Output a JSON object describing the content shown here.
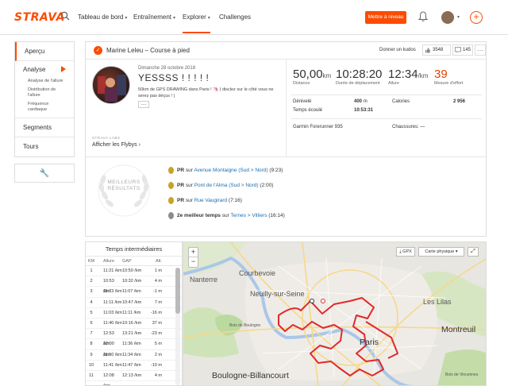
{
  "nav": {
    "logo": "STRAVA",
    "items": [
      {
        "label": "Tableau de bord",
        "caret": "▾"
      },
      {
        "label": "Entraînement",
        "caret": "▾"
      },
      {
        "label": "Explorer",
        "caret": "▾"
      },
      {
        "label": "Challenges",
        "caret": ""
      }
    ],
    "upgrade_label": "Mettre à niveau",
    "accent": "#fc4c02"
  },
  "sidebar": {
    "items": [
      "Aperçu",
      "Analyse",
      "Segments",
      "Tours"
    ],
    "analyse_sub": [
      "Analyse de l'allure",
      "Distribution de l'allure",
      "Fréquence cardiaque"
    ]
  },
  "activity": {
    "title": "Marine Leleu – Course à pied",
    "kudos_link": "Donner un kudos",
    "kudos_count": "3548",
    "comment_count": "145",
    "date": "Dimanche 28 octobre 2018",
    "name": "YESSSS ! ! ! ! !",
    "description": "50km de GPS DRAWING dans Paris ! 🦄 ( disclez sur le côté vous ne serez pas déçus ! )",
    "labs_label": "STRAVA LABS",
    "flyby_label": "Afficher les Flybys  ›",
    "stats": [
      {
        "value": "50,00",
        "unit": "km",
        "label": "Distance"
      },
      {
        "value": "10:28:20",
        "unit": "",
        "label": "Durée de déplacement"
      },
      {
        "value": "12:34",
        "unit": "/km",
        "label": "Allure"
      },
      {
        "value": "39",
        "unit": "",
        "label": "Mesure d'effort"
      }
    ],
    "details": {
      "elevation_label": "Dénivelé",
      "elevation_value": "400",
      "elevation_unit": "m",
      "calories_label": "Calories",
      "calories_value": "2 956",
      "elapsed_label": "Temps écoulé",
      "elapsed_value": "10:53:31",
      "device": "Garmin Forerunner 935",
      "shoes_label": "Chaussures:",
      "shoes_value": "—"
    }
  },
  "results": {
    "title_line1": "MEILLEURS",
    "title_line2": "RÉSULTATS",
    "rows": [
      {
        "prefix": "PR",
        "mid": " sur ",
        "link": "Avenue Montaigne (Sud > Nord)",
        "suffix": " (9:23)",
        "medal": "gold"
      },
      {
        "prefix": "PR",
        "mid": " sur ",
        "link": "Pont de l'Alma (Sud > Nord)",
        "suffix": " (2:00)",
        "medal": "gold"
      },
      {
        "prefix": "PR",
        "mid": " sur ",
        "link": "Rue Vaugirard",
        "suffix": " (7:16)",
        "medal": "gold"
      },
      {
        "prefix": "2e meilleur temps",
        "mid": " sur ",
        "link": "Ternes > Villiers",
        "suffix": " (16:14)",
        "medal": "silver"
      }
    ]
  },
  "splits": {
    "title": "Temps intermédiaires",
    "headers": [
      "KM",
      "Allure",
      "GAP",
      "Alt."
    ],
    "rows": [
      [
        "1",
        "11:21 /km",
        "10:50 /km",
        "1",
        "m"
      ],
      [
        "2",
        "10:53 /km",
        "10:32 /km",
        "4",
        "m"
      ],
      [
        "3",
        "11:23 /km",
        "11:07 /km",
        "-1",
        "m"
      ],
      [
        "4",
        "11:11 /km",
        "10:47 /km",
        "7",
        "m"
      ],
      [
        "5",
        "11:03 /km",
        "11:11 /km",
        "-16",
        "m"
      ],
      [
        "6",
        "11:40 /km",
        "10:16 /km",
        "37",
        "m"
      ],
      [
        "7",
        "12:53 /km",
        "13:21 /km",
        "-23",
        "m"
      ],
      [
        "8",
        "12:00 /km",
        "11:36 /km",
        "5",
        "m"
      ],
      [
        "9",
        "11:50 /km",
        "11:34 /km",
        "2",
        "m"
      ],
      [
        "10",
        "11:41 /km",
        "11:47 /km",
        "-10",
        "m"
      ],
      [
        "11",
        "12:08 /km",
        "12:13 /km",
        "4",
        "m"
      ]
    ]
  },
  "map": {
    "gpx_label": "⤓ GPX",
    "maptype_label": "Carte physique ▾",
    "labels": [
      {
        "text": "Nanterre",
        "size": "normal"
      },
      {
        "text": "Courbevoie",
        "size": "normal"
      },
      {
        "text": "Neuilly-sur-Seine",
        "size": "normal"
      },
      {
        "text": "Les Lilas",
        "size": "normal"
      },
      {
        "text": "Montreuil",
        "size": "normal"
      },
      {
        "text": "Paris",
        "size": "big"
      },
      {
        "text": "Boulogne-Billancourt",
        "size": "big"
      },
      {
        "text": "Bois de Boulogne",
        "size": "small"
      },
      {
        "text": "Bois de Vincennes",
        "size": "small"
      }
    ],
    "route_color": "#e0292b"
  }
}
